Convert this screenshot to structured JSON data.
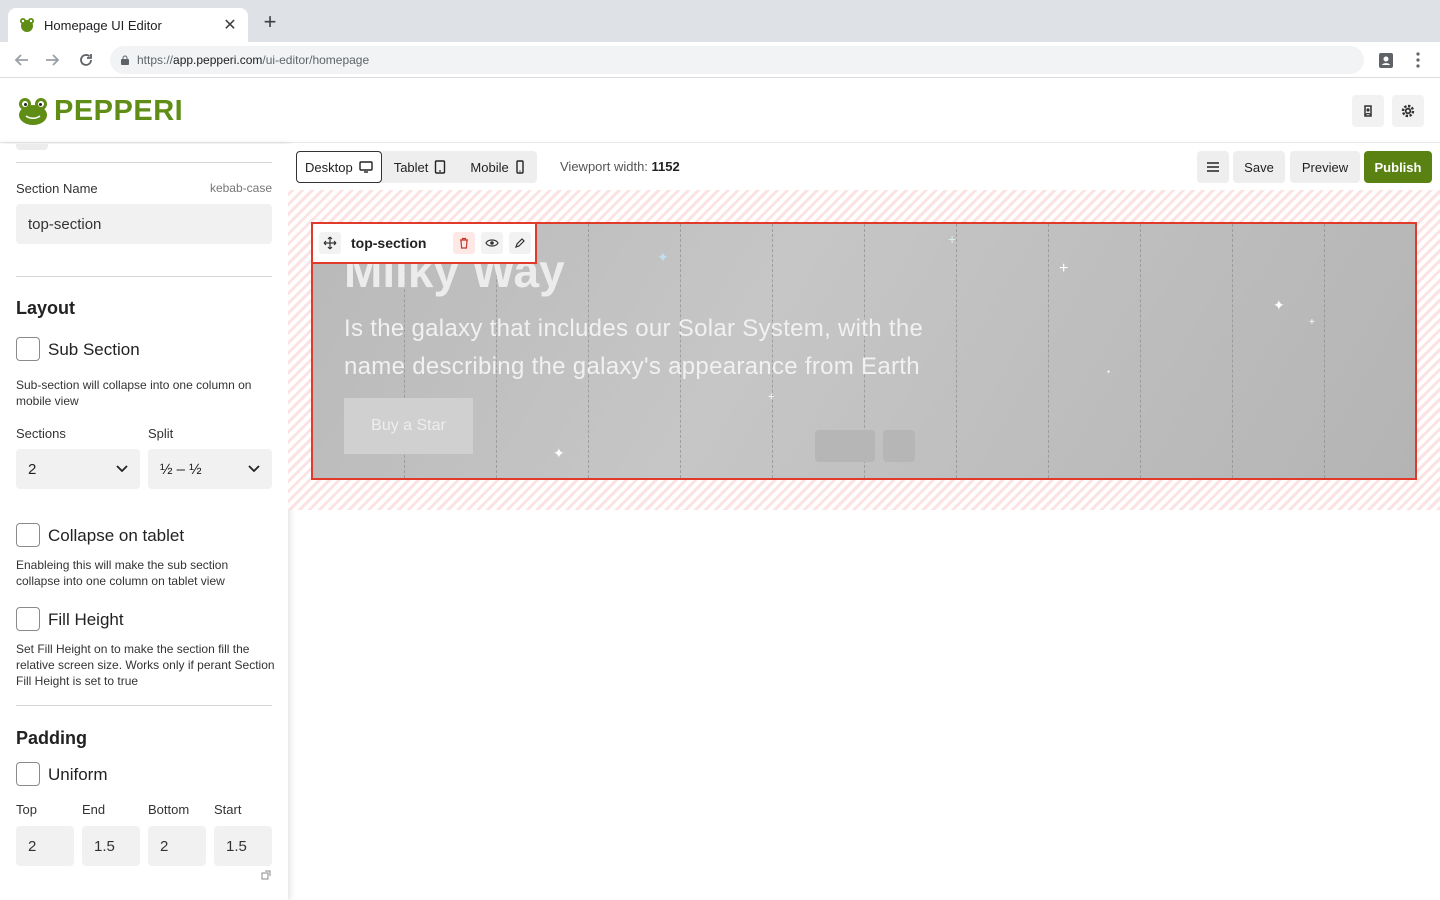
{
  "browser": {
    "tab_title": "Homepage UI Editor",
    "tab_close": "✕",
    "new_tab": "+",
    "url_scheme": "https://",
    "url_host": "app.pepperi.com",
    "url_path": "/ui-editor/homepage"
  },
  "app": {
    "brand": "PEPPERI",
    "brand_color": "#5f8d16"
  },
  "panel": {
    "section_name_label": "Section Name",
    "section_name_hint": "kebab-case",
    "section_name_value": "top-section",
    "layout_heading": "Layout",
    "sub_section_label": "Sub Section",
    "sub_section_help": "Sub-section will collapse into one column on mobile view",
    "sections_label": "Sections",
    "sections_value": "2",
    "split_label": "Split",
    "split_value": "½ – ½",
    "collapse_label": "Collapse on tablet",
    "collapse_help": "Enableing this will make the sub section collapse into one column on tablet view",
    "fill_height_label": "Fill Height",
    "fill_height_help": "Set Fill Height on to make the section fill the relative screen size. Works only if perant Section Fill Height is set to true",
    "padding_heading": "Padding",
    "uniform_label": "Uniform",
    "padding": {
      "top_label": "Top",
      "top_value": "2",
      "end_label": "End",
      "end_value": "1.5",
      "bottom_label": "Bottom",
      "bottom_value": "2",
      "start_label": "Start",
      "start_value": "1.5"
    }
  },
  "toolbar": {
    "desktop": "Desktop",
    "tablet": "Tablet",
    "mobile": "Mobile",
    "viewport_label": "Viewport width:",
    "viewport_value": "1152",
    "save": "Save",
    "preview": "Preview",
    "publish": "Publish",
    "publish_color": "#5a8212"
  },
  "canvas": {
    "section_tag": "top-section",
    "hero_title": "Milky Way",
    "hero_text": "Is the galaxy that includes our Solar System, with the name describing the galaxy's appearance from Earth",
    "hero_button": "Buy a Star",
    "selection_color": "#e03a2a"
  }
}
